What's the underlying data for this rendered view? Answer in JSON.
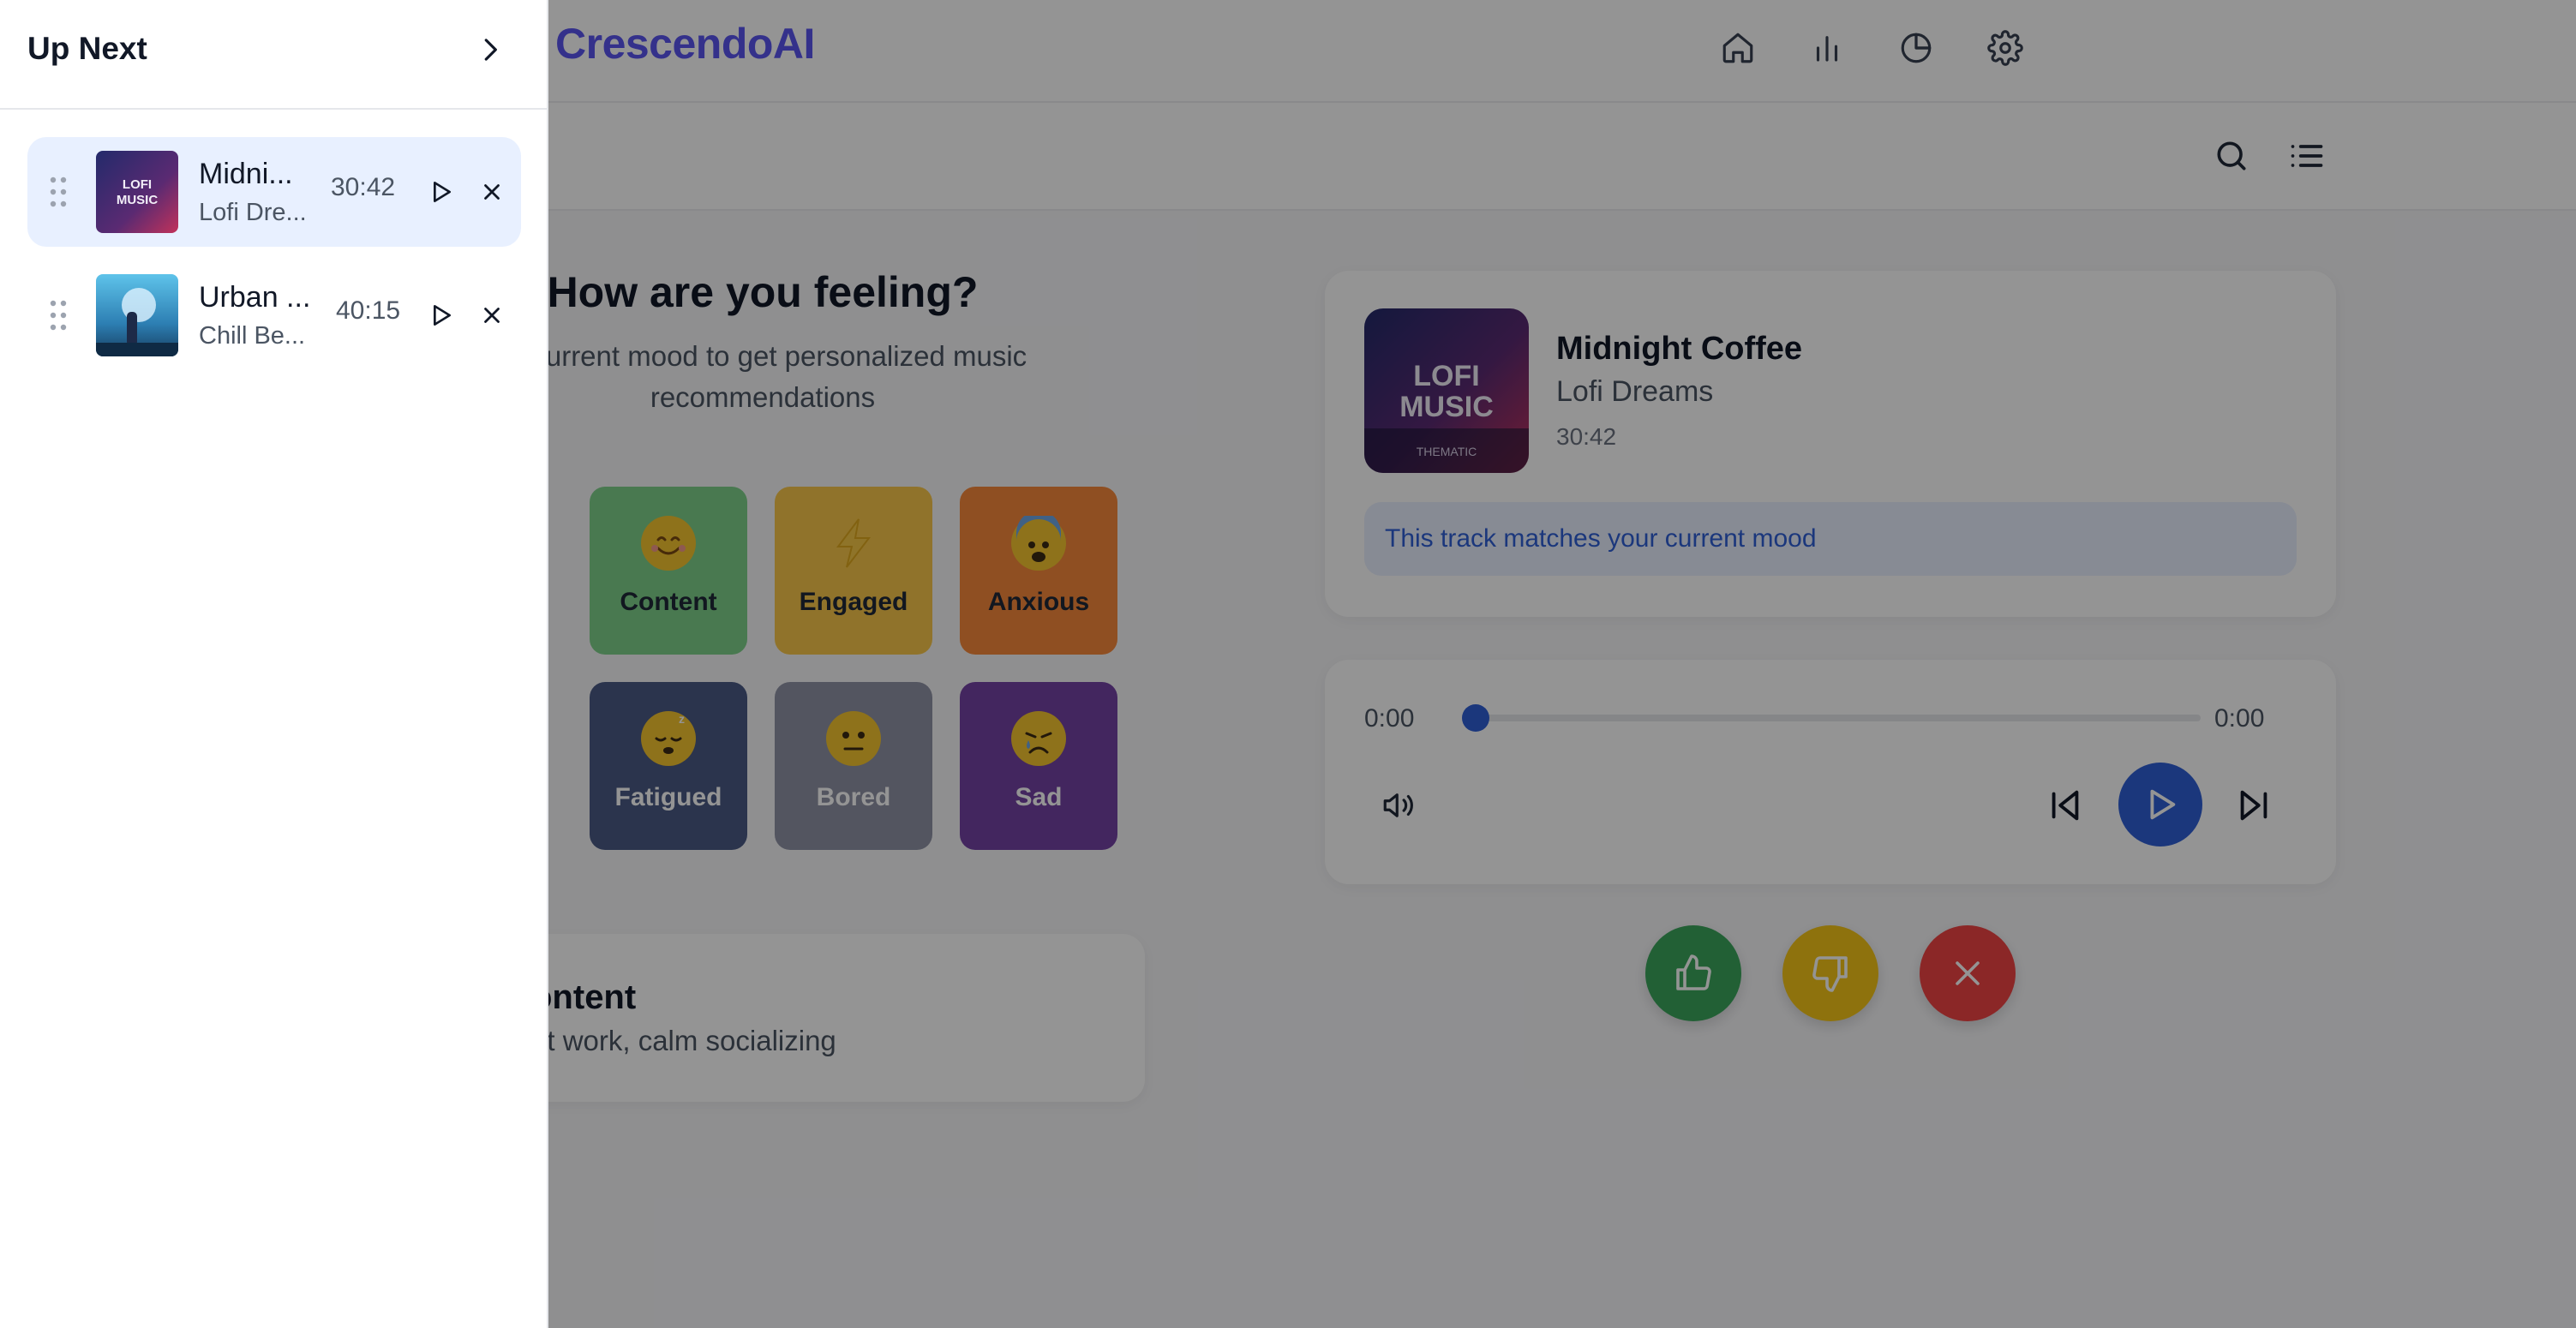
{
  "app": {
    "brand": "CrescendoAI"
  },
  "nav": [
    {
      "id": "home",
      "icon": "home-icon"
    },
    {
      "id": "stats",
      "icon": "bar-chart-icon"
    },
    {
      "id": "insights",
      "icon": "pie-chart-icon"
    },
    {
      "id": "settings",
      "icon": "gear-icon"
    }
  ],
  "toolbar": {
    "search_icon": "search-icon",
    "queue_icon": "list-icon"
  },
  "mood": {
    "title": "How are you feeling?",
    "subtitle_line1": "ur current mood to get personalized music",
    "subtitle_line2": "recommendations",
    "options": [
      {
        "label": "Content",
        "emoji": "smiling-face-icon",
        "color": "#7fd08a"
      },
      {
        "label": "Engaged",
        "emoji": "lightning-icon",
        "color": "#f8c74b"
      },
      {
        "label": "Anxious",
        "emoji": "anxious-face-icon",
        "color": "#f7893b"
      },
      {
        "label": "Fatigued",
        "emoji": "sleepy-face-icon",
        "color": "#4a5a85"
      },
      {
        "label": "Bored",
        "emoji": "neutral-face-icon",
        "color": "#8f93a6"
      },
      {
        "label": "Sad",
        "emoji": "crying-face-icon",
        "color": "#7442a4"
      }
    ],
    "selected": {
      "title": "ontent",
      "description": "ht work, calm socializing"
    }
  },
  "now_playing": {
    "art_text_line1": "LOFI",
    "art_text_line2": "MUSIC",
    "art_caption": "THEMATIC",
    "title": "Midnight Coffee",
    "artist": "Lofi Dreams",
    "duration": "30:42",
    "match_text": "This track matches your current mood"
  },
  "player": {
    "current_time": "0:00",
    "total_time": "0:00",
    "progress": 0.0
  },
  "feedback": {
    "like_color": "#3ba55c",
    "dislike_color": "#f5c518",
    "skip_color": "#ef4444"
  },
  "queue": {
    "title": "Up Next",
    "items": [
      {
        "title": "Midni...",
        "artist": "Lofi Dre...",
        "duration": "30:42",
        "art_text_line1": "LOFI",
        "art_text_line2": "MUSIC",
        "active": true
      },
      {
        "title": "Urban ...",
        "artist": "Chill Be...",
        "duration": "40:15",
        "active": false
      }
    ]
  }
}
